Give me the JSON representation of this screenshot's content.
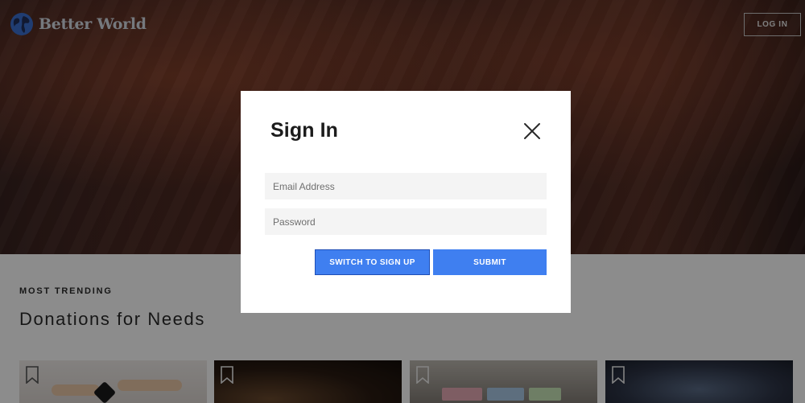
{
  "header": {
    "brand": "Better World",
    "logo_icon": "globe-icon",
    "login_label": "LOG IN"
  },
  "section": {
    "kicker": "MOST TRENDING",
    "title": "Donations for Needs"
  },
  "cards": [
    {
      "icon": "bookmark-icon"
    },
    {
      "icon": "bookmark-icon"
    },
    {
      "icon": "bookmark-icon"
    },
    {
      "icon": "bookmark-icon"
    }
  ],
  "modal": {
    "title": "Sign In",
    "close_icon": "close-icon",
    "email_placeholder": "Email Address",
    "password_placeholder": "Password",
    "switch_label": "SWITCH TO SIGN UP",
    "submit_label": "SUBMIT"
  },
  "colors": {
    "accent": "#3f7ff0",
    "overlay": "rgba(0,0,0,0.45)"
  }
}
